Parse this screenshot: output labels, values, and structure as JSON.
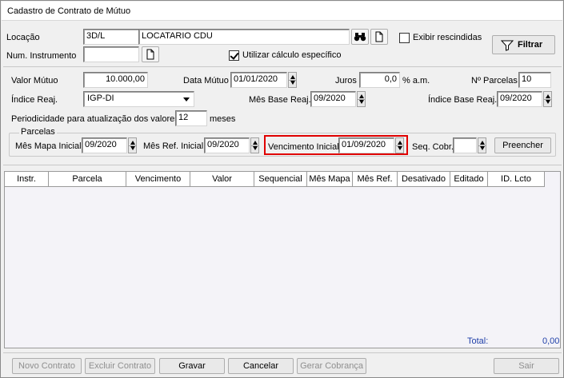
{
  "window": {
    "title": "Cadastro de Contrato de Mútuo"
  },
  "top": {
    "locacao_label": "Locação",
    "locacao_code": "3D/L",
    "locacao_name": "LOCATARIO CDU",
    "exibir_rescindidas_label": "Exibir rescindidas",
    "exibir_rescindidas_checked": false,
    "filtrar_label": "Filtrar",
    "num_instrumento_label": "Num. Instrumento",
    "num_instrumento_value": "",
    "utilizar_calculo_label": "Utilizar cálculo específico",
    "utilizar_calculo_checked": true
  },
  "form": {
    "valor_mutuo_label": "Valor Mútuo",
    "valor_mutuo_value": "10.000,00",
    "data_mutuo_label": "Data Mútuo",
    "data_mutuo_value": "01/01/2020",
    "juros_label": "Juros",
    "juros_value": "0,0",
    "juros_unit": "% a.m.",
    "n_parcelas_label": "Nº Parcelas",
    "n_parcelas_value": "10",
    "indice_reaj_label": "Índice Reaj.",
    "indice_reaj_value": "IGP-DI",
    "mes_base_reaj_label": "Mês Base Reaj.",
    "mes_base_reaj_value": "09/2020",
    "indice_base_reaj_label": "Índice Base Reaj.",
    "indice_base_reaj_value": "09/2020",
    "periodicidade_label": "Periodicidade para atualização dos valores",
    "periodicidade_value": "12",
    "periodicidade_unit": "meses"
  },
  "parcelas": {
    "group_title": "Parcelas",
    "mes_mapa_inicial_label": "Mês Mapa Inicial",
    "mes_mapa_inicial_value": "09/2020",
    "mes_ref_inicial_label": "Mês Ref. Inicial",
    "mes_ref_inicial_value": "09/2020",
    "vencimento_inicial_label": "Vencimento Inicial",
    "vencimento_inicial_value": "01/09/2020",
    "seq_cobr_label": "Seq. Cobr.",
    "seq_cobr_value": "",
    "preencher_label": "Preencher",
    "highlight_color": "#e00000"
  },
  "grid": {
    "columns": [
      "Instr.",
      "Parcela",
      "Vencimento",
      "Valor",
      "Sequencial",
      "Mês Mapa",
      "Mês Ref.",
      "Desativado",
      "Editado",
      "ID. Lcto"
    ],
    "rows": [],
    "total_label": "Total:",
    "total_value": "0,00",
    "total_color": "#1f3fa8"
  },
  "buttons": {
    "novo_contrato": "Novo Contrato",
    "excluir_contrato": "Excluir Contrato",
    "gravar": "Gravar",
    "cancelar": "Cancelar",
    "gerar_cobranca": "Gerar Cobrança",
    "sair": "Sair"
  },
  "icons": {
    "search": "binoculars-icon",
    "new": "document-icon",
    "filter": "funnel-icon"
  }
}
